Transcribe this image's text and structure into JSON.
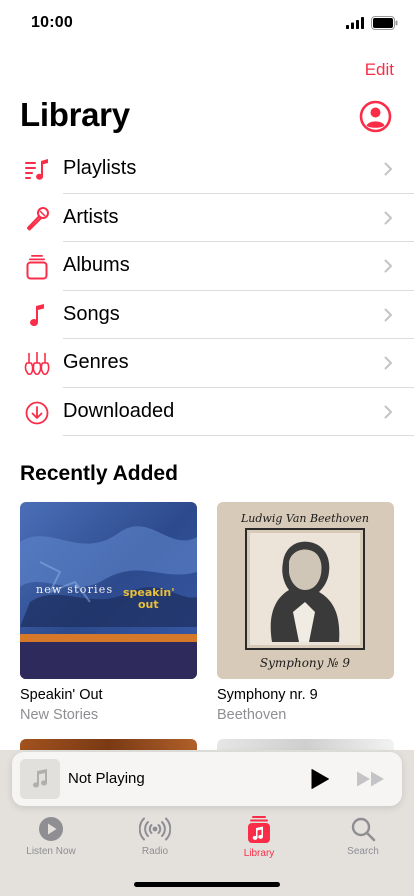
{
  "status": {
    "time": "10:00"
  },
  "header": {
    "edit_label": "Edit",
    "title": "Library",
    "account_icon": "account-circle-icon"
  },
  "library_items": [
    {
      "label": "Playlists",
      "icon": "playlist-icon"
    },
    {
      "label": "Artists",
      "icon": "microphone-icon"
    },
    {
      "label": "Albums",
      "icon": "album-stack-icon"
    },
    {
      "label": "Songs",
      "icon": "music-note-icon"
    },
    {
      "label": "Genres",
      "icon": "guitars-icon"
    },
    {
      "label": "Downloaded",
      "icon": "download-circle-icon"
    }
  ],
  "recently_added": {
    "title": "Recently Added",
    "albums": [
      {
        "title": "Speakin' Out",
        "artist": "New Stories",
        "cover_text_1": "new stories",
        "cover_text_2": "speakin'",
        "cover_text_3": "out"
      },
      {
        "title": "Symphony nr. 9",
        "artist": "Beethoven",
        "cover_text_1": "Ludwig Van Beethoven",
        "cover_text_2": "Symphony № 9"
      }
    ]
  },
  "player": {
    "title": "Not Playing"
  },
  "tabs": [
    {
      "label": "Listen Now",
      "icon": "play-circle-icon",
      "active": false
    },
    {
      "label": "Radio",
      "icon": "radio-waves-icon",
      "active": false
    },
    {
      "label": "Library",
      "icon": "library-music-icon",
      "active": true
    },
    {
      "label": "Search",
      "icon": "search-icon",
      "active": false
    }
  ],
  "colors": {
    "accent": "#fa2d48",
    "secondary_text": "#8e8e93",
    "tab_background": "#e4e1dd"
  }
}
